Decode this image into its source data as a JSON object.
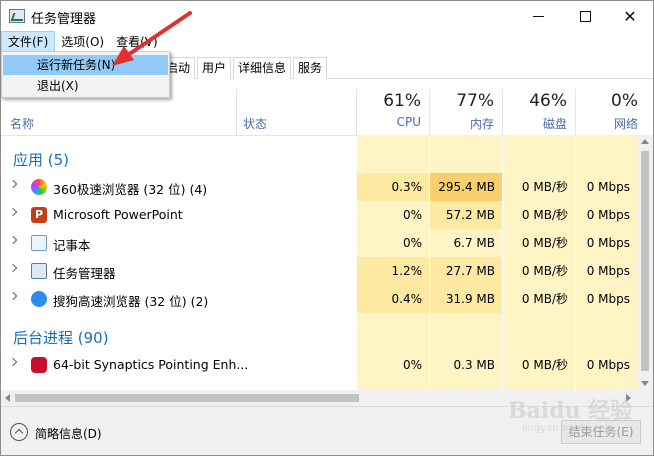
{
  "window": {
    "title": "任务管理器",
    "min_symbol": "",
    "close_symbol": "✕"
  },
  "menubar": {
    "file": "文件(F)",
    "options": "选项(O)",
    "view": "查看(V)"
  },
  "file_menu": {
    "items": [
      "运行新任务(N)",
      "退出(X)"
    ]
  },
  "tabs": [
    "启动",
    "用户",
    "详细信息",
    "服务"
  ],
  "header": {
    "name": "名称",
    "status": "状态",
    "cpu_pct": "61%",
    "cpu_label": "CPU",
    "mem_pct": "77%",
    "mem_label": "内存",
    "disk_pct": "46%",
    "disk_label": "磁盘",
    "net_pct": "0%",
    "net_label": "网络"
  },
  "groups": {
    "apps": "应用 (5)",
    "background": "后台进程 (90)"
  },
  "processes": [
    {
      "name": "360极速浏览器 (32 位) (4)",
      "icon": "browser-360-icon",
      "cpu": "0.3%",
      "mem": "295.4 MB",
      "disk": "0 MB/秒",
      "net": "0 Mbps"
    },
    {
      "name": "Microsoft PowerPoint",
      "icon": "powerpoint-icon",
      "cpu": "0%",
      "mem": "57.2 MB",
      "disk": "0 MB/秒",
      "net": "0 Mbps"
    },
    {
      "name": "记事本",
      "icon": "notepad-icon",
      "cpu": "0%",
      "mem": "6.7 MB",
      "disk": "0 MB/秒",
      "net": "0 Mbps"
    },
    {
      "name": "任务管理器",
      "icon": "task-manager-icon",
      "cpu": "1.2%",
      "mem": "27.7 MB",
      "disk": "0 MB/秒",
      "net": "0 Mbps"
    },
    {
      "name": "搜狗高速浏览器 (32 位) (2)",
      "icon": "sogou-browser-icon",
      "cpu": "0.4%",
      "mem": "31.9 MB",
      "disk": "0 MB/秒",
      "net": "0 Mbps"
    }
  ],
  "background_processes": [
    {
      "name": "64-bit Synaptics Pointing Enh...",
      "icon": "synaptics-icon",
      "cpu": "0%",
      "mem": "0.3 MB",
      "disk": "0 MB/秒",
      "net": "0 Mbps"
    }
  ],
  "footer": {
    "fewer_details": "简略信息(D)",
    "end_task": "结束任务(E)"
  },
  "watermark": {
    "main": "Baidu 经验",
    "sub": "jingyan.baidu.com"
  },
  "colors": {
    "accent_blue": "#1a6fb8",
    "menu_hover": "#91c9f7",
    "highlight_yellow": "#fff4c4",
    "mem_high": "#f7d06d",
    "annotation_red": "#e03030"
  }
}
